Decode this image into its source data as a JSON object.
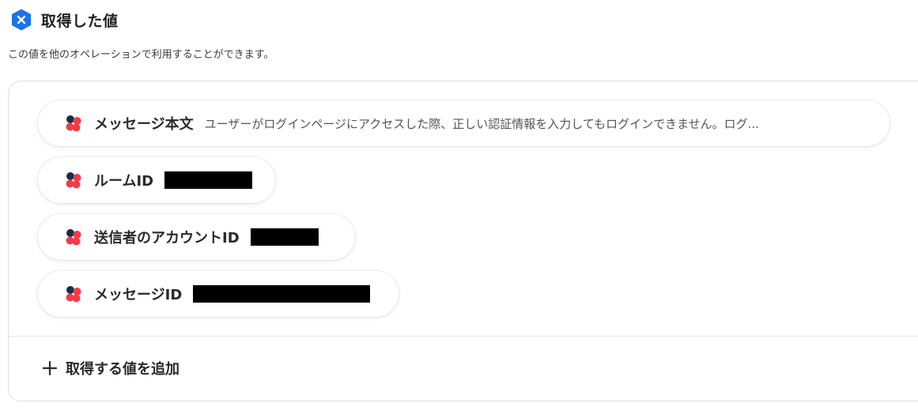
{
  "header": {
    "badge_icon": "x-close-icon",
    "badge_color": "#1a73e8",
    "title": "取得した値",
    "subtitle": "この値を他のオペレーションで利用することができます。"
  },
  "values": [
    {
      "icon": "chatwork-logo-icon",
      "label": "メッセージ本文",
      "value": "ユーザーがログインページにアクセスした際、正しい認証情報を入力してもログインできません。ログ...",
      "redacted": false
    },
    {
      "icon": "chatwork-logo-icon",
      "label": "ルームID",
      "value": "",
      "redacted": true
    },
    {
      "icon": "chatwork-logo-icon",
      "label": "送信者のアカウントID",
      "value": "",
      "redacted": true
    },
    {
      "icon": "chatwork-logo-icon",
      "label": "メッセージID",
      "value": "",
      "redacted": true
    }
  ],
  "add": {
    "icon": "plus-icon",
    "label": "取得する値を追加"
  },
  "colors": {
    "brand_red": "#f03c46",
    "brand_dark": "#1f2a44",
    "accent_blue": "#1a73e8"
  }
}
